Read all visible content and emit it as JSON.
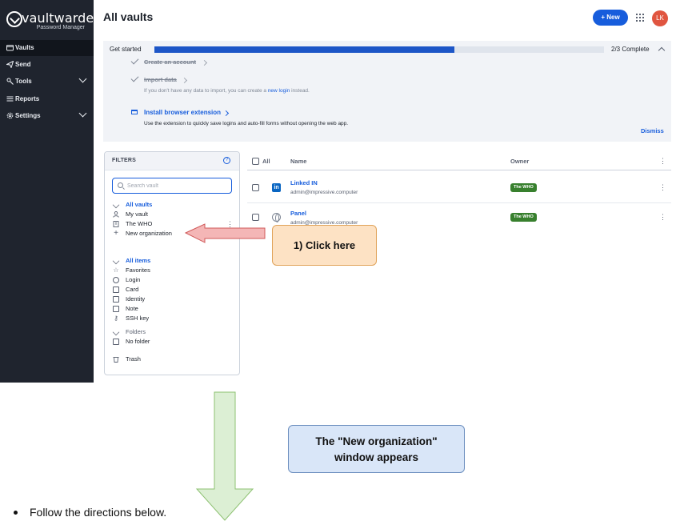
{
  "app": {
    "logo_word": "vaultwarden",
    "logo_sub": "Password Manager"
  },
  "sidebar": {
    "items": [
      {
        "label": "Vaults",
        "icon": "vault-icon",
        "active": true
      },
      {
        "label": "Send",
        "icon": "send-icon",
        "active": false
      },
      {
        "label": "Tools",
        "icon": "tools-icon",
        "active": false,
        "expandable": true
      },
      {
        "label": "Reports",
        "icon": "reports-icon",
        "active": false
      },
      {
        "label": "Settings",
        "icon": "gear-icon",
        "active": false,
        "expandable": true
      }
    ]
  },
  "header": {
    "title": "All vaults",
    "new_label": "+ New",
    "avatar_initials": "LK"
  },
  "get_started": {
    "title": "Get started",
    "progress_fraction": 0.6667,
    "count_label": "2/3 Complete",
    "steps": [
      {
        "label": "Create an account",
        "done": true
      },
      {
        "label": "Import data",
        "done": true,
        "note_before": "If you don't have any data to import, you can create a ",
        "note_link": "new login",
        "note_after": " instead."
      },
      {
        "label": "Install browser extension",
        "done": false,
        "note": "Use the extension to quickly save logins and auto-fill forms without opening the web app."
      }
    ],
    "dismiss_label": "Dismiss"
  },
  "filters": {
    "title": "FILTERS",
    "help_glyph": "?",
    "search_placeholder": "Search vault",
    "vaults": {
      "heading": "All vaults",
      "items": [
        "My vault",
        "The WHO",
        "New organization"
      ]
    },
    "types": {
      "heading": "All items",
      "items": [
        "Favorites",
        "Login",
        "Card",
        "Identity",
        "Note",
        "SSH key"
      ]
    },
    "folders": {
      "heading": "Folders",
      "items": [
        "No folder"
      ]
    },
    "trash_label": "Trash"
  },
  "vault_table": {
    "columns": [
      "All",
      "Name",
      "Owner"
    ],
    "rows": [
      {
        "name": "Linked IN",
        "username": "admin@impressive.computer",
        "owner": "The WHO",
        "icon": "linkedin-icon",
        "icon_text": "in"
      },
      {
        "name": "Panel",
        "username": "admin@impressive.computer",
        "owner": "The WHO",
        "icon": "globe-icon"
      }
    ]
  },
  "annotations": {
    "callout_1": "1) Click here",
    "result_line_1": "The \"New organization\"",
    "result_line_2": "window appears",
    "instruction": "Follow the directions below."
  },
  "colors": {
    "sidebar_bg": "#1f242e",
    "brand_blue": "#175ddc",
    "owner_badge": "#38802e",
    "avatar": "#e05540",
    "callout_fill": "#fde2c4",
    "arrow_red": "#f4b6b6",
    "arrow_green": "#dcefd4",
    "note_fill": "#d9e6f8"
  }
}
